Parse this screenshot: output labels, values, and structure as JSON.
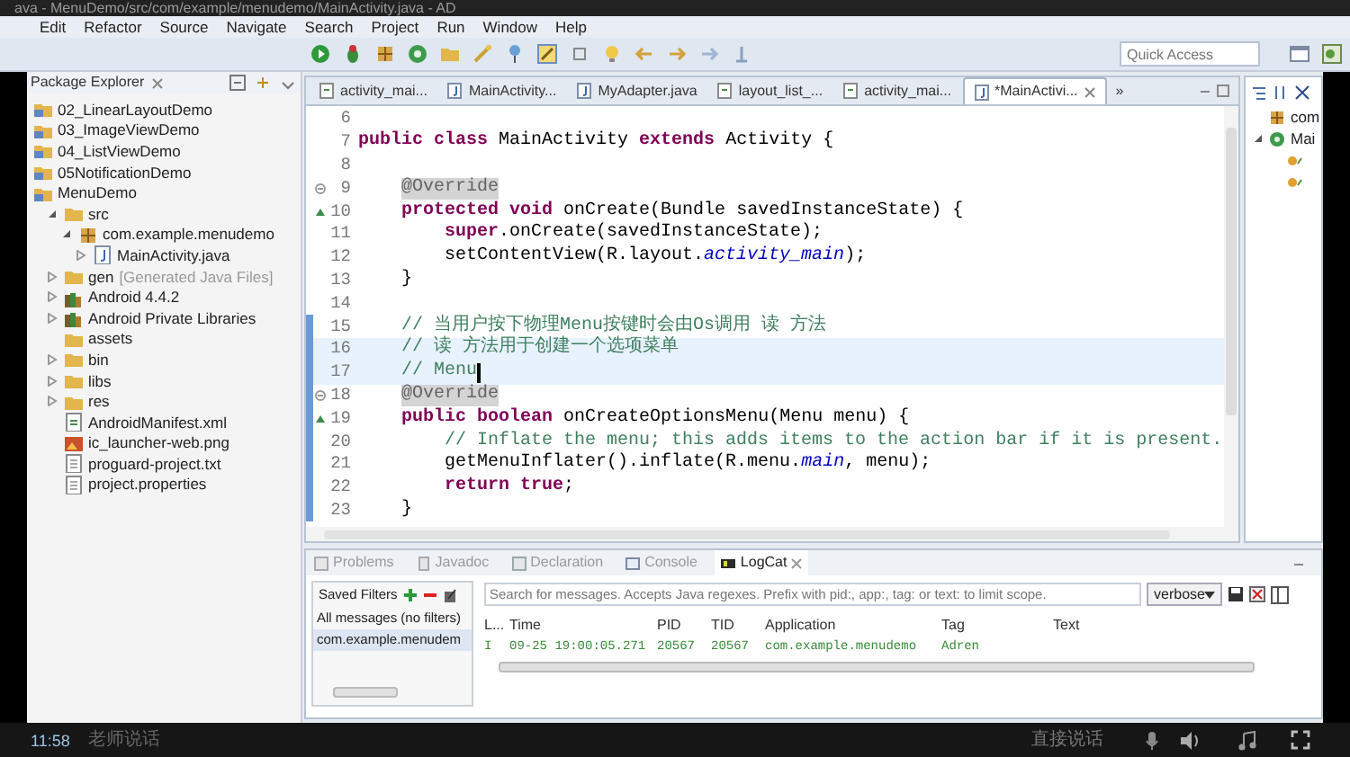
{
  "title_bar": {
    "title": "ava - MenuDemo/src/com/example/menudemo/MainActivity.java - AD"
  },
  "menu_bar": [
    "Edit",
    "Refactor",
    "Source",
    "Navigate",
    "Search",
    "Project",
    "Run",
    "Window",
    "Help"
  ],
  "toolbar": {
    "quick_access": {
      "placeholder": "Quick Access"
    }
  },
  "package_explorer": {
    "title": "Package Explorer",
    "tree": [
      {
        "label": "02_LinearLayoutDemo",
        "kind": "project"
      },
      {
        "label": "03_ImageViewDemo",
        "kind": "project"
      },
      {
        "label": "04_ListViewDemo",
        "kind": "project"
      },
      {
        "label": "05NotificationDemo",
        "kind": "project"
      },
      {
        "label": "MenuDemo",
        "kind": "project",
        "children": [
          {
            "label": "src",
            "kind": "folder",
            "expanded": true,
            "children": [
              {
                "label": "com.example.menudemo",
                "kind": "package",
                "expanded": true,
                "children": [
                  {
                    "label": "MainActivity.java",
                    "kind": "java-file",
                    "expanded": false
                  }
                ]
              }
            ]
          },
          {
            "label": "gen",
            "decoration": "[Generated Java Files]",
            "kind": "folder",
            "expanded": false
          },
          {
            "label": "Android 4.4.2",
            "kind": "library",
            "expanded": false
          },
          {
            "label": "Android Private Libraries",
            "kind": "library",
            "expanded": false
          },
          {
            "label": "assets",
            "kind": "folder"
          },
          {
            "label": "bin",
            "kind": "folder",
            "expanded": false
          },
          {
            "label": "libs",
            "kind": "folder",
            "expanded": false
          },
          {
            "label": "res",
            "kind": "folder",
            "expanded": false
          },
          {
            "label": "AndroidManifest.xml",
            "kind": "xml-file"
          },
          {
            "label": "ic_launcher-web.png",
            "kind": "image-file"
          },
          {
            "label": "proguard-project.txt",
            "kind": "text-file"
          },
          {
            "label": "project.properties",
            "kind": "text-file"
          }
        ]
      }
    ]
  },
  "editor": {
    "tabs": [
      {
        "label": "activity_mai...",
        "kind": "xml",
        "selected": false
      },
      {
        "label": "MainActivity...",
        "kind": "java",
        "selected": false
      },
      {
        "label": "MyAdapter.java",
        "kind": "java",
        "selected": false
      },
      {
        "label": "layout_list_...",
        "kind": "xml",
        "selected": false
      },
      {
        "label": "activity_mai...",
        "kind": "xml",
        "selected": false
      },
      {
        "label": "*MainActivi...",
        "kind": "java",
        "selected": true
      }
    ],
    "overflow": "»",
    "lines": [
      {
        "number": "6",
        "changed": false,
        "highlighted": false,
        "kind": "code"
      },
      {
        "number": "7",
        "changed": false,
        "highlighted": false,
        "kind": "code",
        "segments": [
          {
            "text": "public class",
            "kind": "keyword"
          },
          {
            "text": " MainActivity ",
            "kind": "plain"
          },
          {
            "text": "extends",
            "kind": "keyword"
          },
          {
            "text": " Activity {",
            "kind": "plain"
          }
        ]
      },
      {
        "number": "8",
        "changed": false,
        "highlighted": false,
        "kind": "code"
      },
      {
        "number": "9",
        "changed": false,
        "highlighted": false,
        "kind": "fold",
        "segments": [
          {
            "text": "    @Override",
            "kind": "annotation-marked"
          }
        ]
      },
      {
        "number": "10",
        "changed": false,
        "highlighted": false,
        "kind": "override",
        "segments": [
          {
            "text": "    protected void",
            "kind": "keyword"
          },
          {
            "text": " onCreate(Bundle savedInstanceState) {",
            "kind": "plain"
          }
        ]
      },
      {
        "number": "11",
        "changed": false,
        "highlighted": false,
        "kind": "code",
        "segments": [
          {
            "text": "        super",
            "kind": "keyword"
          },
          {
            "text": ".onCreate(savedInstanceState);",
            "kind": "plain"
          }
        ]
      },
      {
        "number": "12",
        "changed": false,
        "highlighted": false,
        "kind": "code",
        "segments": [
          {
            "text": "        setContentView(R.layout.",
            "kind": "plain"
          },
          {
            "text": "activity_main",
            "kind": "field"
          },
          {
            "text": ");",
            "kind": "plain"
          }
        ]
      },
      {
        "number": "13",
        "changed": false,
        "highlighted": false,
        "kind": "code",
        "segments": [
          {
            "text": "    }",
            "kind": "plain"
          }
        ]
      },
      {
        "number": "14",
        "changed": false,
        "highlighted": false,
        "kind": "code"
      },
      {
        "number": "15",
        "changed": true,
        "highlighted": false,
        "kind": "code",
        "segments": [
          {
            "text": "    // 当用户按下物理Menu按键时会由Os调用 读 方法",
            "kind": "comment"
          }
        ]
      },
      {
        "number": "16",
        "changed": true,
        "highlighted": true,
        "kind": "code",
        "segments": [
          {
            "text": "    // 读 方法用于创建一个选项菜单",
            "kind": "comment"
          }
        ]
      },
      {
        "number": "17",
        "changed": true,
        "highlighted": true,
        "cursor": true,
        "kind": "code",
        "segments": [
          {
            "text": "    // Menu",
            "kind": "comment"
          }
        ]
      },
      {
        "number": "18",
        "changed": true,
        "highlighted": false,
        "kind": "fold",
        "segments": [
          {
            "text": "    @Override",
            "kind": "annotation-marked"
          }
        ]
      },
      {
        "number": "19",
        "changed": true,
        "highlighted": false,
        "kind": "override",
        "segments": [
          {
            "text": "    public boolean",
            "kind": "keyword"
          },
          {
            "text": " onCreateOptionsMenu(Menu menu) {",
            "kind": "plain"
          }
        ]
      },
      {
        "number": "20",
        "changed": true,
        "highlighted": false,
        "kind": "code",
        "segments": [
          {
            "text": "        // Inflate the menu; this adds items to the action bar if it is present.",
            "kind": "comment"
          }
        ]
      },
      {
        "number": "21",
        "changed": true,
        "highlighted": false,
        "kind": "code",
        "segments": [
          {
            "text": "        getMenuInflater().inflate(R.menu.",
            "kind": "plain"
          },
          {
            "text": "main",
            "kind": "field"
          },
          {
            "text": ", menu);",
            "kind": "plain"
          }
        ]
      },
      {
        "number": "22",
        "changed": true,
        "highlighted": false,
        "kind": "code",
        "segments": [
          {
            "text": "        return true",
            "kind": "keyword"
          },
          {
            "text": ";",
            "kind": "plain"
          }
        ]
      },
      {
        "number": "23",
        "changed": true,
        "highlighted": false,
        "kind": "code",
        "segments": [
          {
            "text": "    }",
            "kind": "plain"
          }
        ]
      }
    ]
  },
  "outline": {
    "items": [
      {
        "label": "com",
        "kind": "package"
      },
      {
        "label": "Mai",
        "kind": "class",
        "expanded": true,
        "children": [
          {
            "kind": "method"
          },
          {
            "kind": "method"
          }
        ]
      }
    ]
  },
  "bottom_panel": {
    "tabs": [
      {
        "label": "Problems",
        "selected": false
      },
      {
        "label": "Javadoc",
        "selected": false
      },
      {
        "label": "Declaration",
        "selected": false
      },
      {
        "label": "Console",
        "selected": false
      },
      {
        "label": "LogCat",
        "selected": true
      }
    ],
    "saved_filters": {
      "title": "Saved Filters",
      "filters": [
        {
          "label": "All messages (no filters)",
          "selected": false
        },
        {
          "label": "com.example.menudem",
          "selected": true
        }
      ]
    },
    "search": {
      "placeholder": "Search for messages. Accepts Java regexes. Prefix with pid:, app:, tag: or text: to limit scope."
    },
    "level_select": "verbose",
    "table": {
      "columns": [
        "L...",
        "Time",
        "PID",
        "TID",
        "Application",
        "Tag",
        "Text"
      ],
      "rows": [
        [
          "I",
          "09-25 19:00:05.271",
          "20567",
          "20567",
          "com.example.menudemo",
          "Adren"
        ]
      ]
    }
  },
  "player_bar": {
    "time": "11:58",
    "caption": "老师说话",
    "action": "直接说话"
  }
}
